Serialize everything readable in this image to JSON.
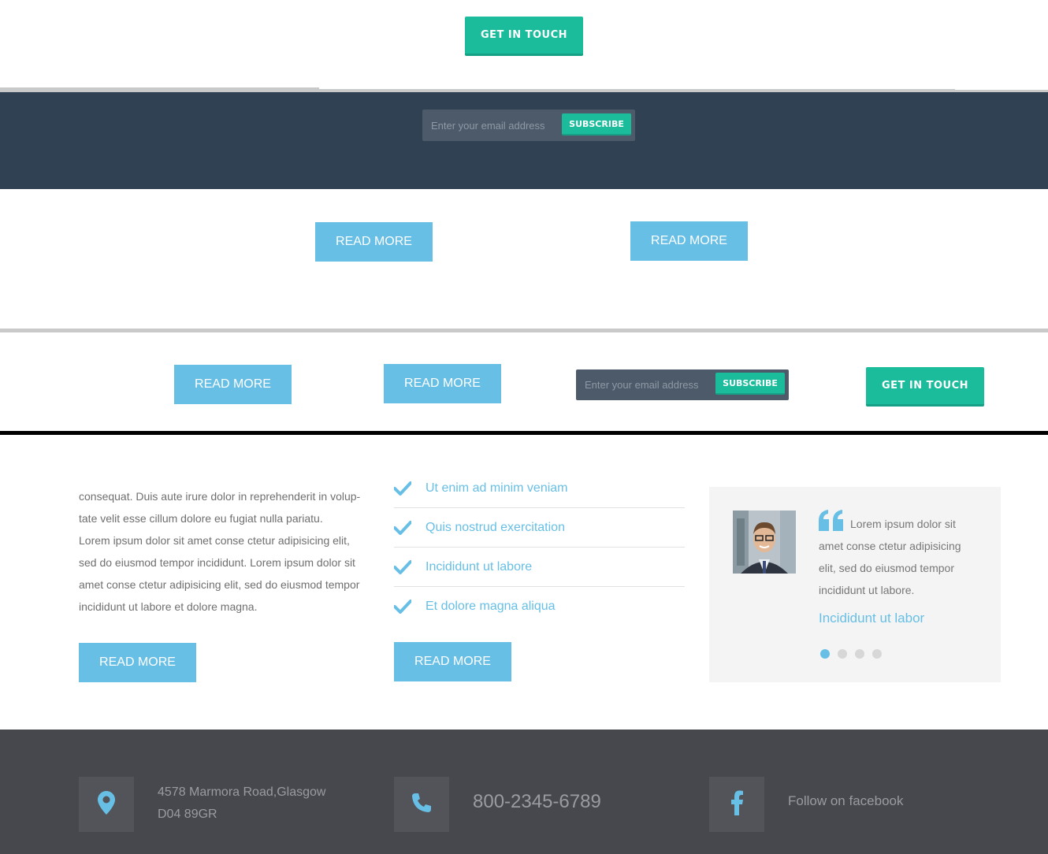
{
  "top": {
    "get_in_touch_label": "GET IN TOUCH"
  },
  "subscribe_bar": {
    "placeholder": "Enter your email address",
    "button_label": "SUBSCRIBE"
  },
  "buttons_row1": {
    "read_more_1": "READ MORE",
    "read_more_2": "READ MORE"
  },
  "buttons_row2": {
    "read_more_1": "READ MORE",
    "read_more_2": "READ MORE",
    "subscribe_placeholder": "Enter your email address",
    "subscribe_label": "SUBSCRIBE",
    "get_in_touch_label": "GET IN TOUCH"
  },
  "content": {
    "paragraph": [
      "consequat. Duis aute irure dolor in reprehenderit in volup-",
      "tate velit esse cillum dolore eu fugiat nulla pariatu.",
      "Lorem ipsum dolor sit amet conse ctetur adipisicing elit,",
      "sed do eiusmod tempor incididunt. Lorem ipsum dolor sit",
      "amet conse ctetur adipisicing elit, sed do eiusmod tempor",
      "incididunt ut labore et dolore magna."
    ],
    "paragraph_button": "READ MORE",
    "checklist": [
      "Ut enim ad minim veniam",
      "Quis nostrud exercitation",
      "Incididunt ut labore",
      "Et dolore magna aliqua"
    ],
    "checklist_button": "READ MORE",
    "testimonial": {
      "quote": "Lorem ipsum dolor sit amet conse ctetur adipisicing elit, sed do eiusmod tempor incididunt ut labore.",
      "author": "Incididunt ut labor",
      "dots_total": 4,
      "dots_active": 1
    }
  },
  "footer": {
    "address_line1": "4578 Marmora Road,Glasgow",
    "address_line2": "D04 89GR",
    "phone": "800-2345-6789",
    "facebook": "Follow on facebook"
  },
  "colors": {
    "accent_green": "#1abc9c",
    "accent_blue": "#67bfe6",
    "dark_band": "#304154",
    "footer_bg": "#47484d"
  }
}
